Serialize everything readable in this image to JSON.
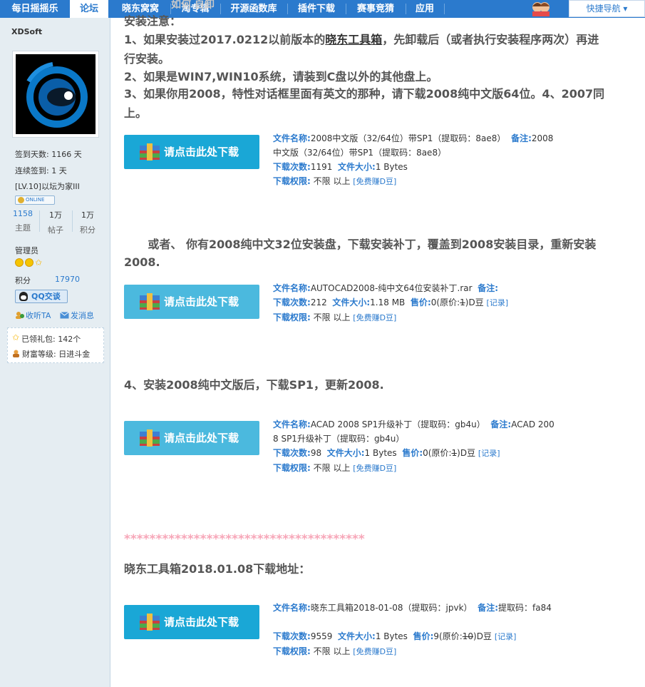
{
  "nav": {
    "items": [
      "每日摇摇乐",
      "论坛",
      "晓东窝窝",
      "淘专辑",
      "开源函数库",
      "插件下载",
      "赛事竞猜",
      "应用"
    ],
    "active_index": 1,
    "quick_nav": "快捷导航 ▾"
  },
  "sidebar": {
    "username": "XDSoft",
    "sign_days": "签到天数: 1166 天",
    "cont_days": "连续签到: 1 天",
    "level": "[LV.10]以坛为家III",
    "online": "ONLINE",
    "counts": [
      {
        "num": "1158",
        "label": "主题"
      },
      {
        "num": "1万",
        "label": "帖子"
      },
      {
        "num": "1万",
        "label": "积分"
      }
    ],
    "role": "管理员",
    "points_label": "积分",
    "points_value": "17970",
    "qq_button": "QQ交谈",
    "follow": "收听TA",
    "message": "发消息",
    "gifts": "已领礼包: 142个",
    "wealth": "财富等级: 日进斗金"
  },
  "content": {
    "ghost": "如何 自卸",
    "p1_l1": "安装注意：",
    "p1_l2_a": "1、如果安装过2017.0212以前版本的",
    "p1_l2_link": "晓东工具箱",
    "p1_l2_b": "，先卸载后（或者执行安装程序两次）再进",
    "p1_l3": "行安装。",
    "p1_l4": "2、如果是WIN7,WIN10系统，请装到C盘以外的其他盘上。",
    "p1_l5": "3、如果你用2008，特性对话框里面有英文的那种，请下载2008纯中文版64位。4、2007同",
    "p1_l6": "上。",
    "p2_l1": "      或者、 你有2008纯中文32位安装盘，下载安装补丁，覆盖到2008安装目录，重新安装",
    "p2_l2": "2008.",
    "p3": "4、安装2008纯中文版后，下载SP1，更新2008.",
    "stars": "**************************************",
    "p4": "晓东工具箱2018.01.08下载地址："
  },
  "download_label": "请点击此处下载",
  "downloads": [
    {
      "name_key": "文件名称:",
      "name": "2008中文版（32/64位）带SP1（提取码：8ae8）",
      "note_key": "备注:",
      "note": "2008",
      "note_cont": "中文版（32/64位）带SP1（提取码：8ae8）",
      "count_key": "下载次数:",
      "count": "1191",
      "size_key": "文件大小:",
      "size": "1 Bytes",
      "perm_key": "下载权限:",
      "perm": "不限 以上",
      "free": "[免费赚D豆]"
    },
    {
      "name_key": "文件名称:",
      "name": "AUTOCAD2008-纯中文64位安装补丁.rar",
      "note_key": "备注:",
      "count_key": "下载次数:",
      "count": "212",
      "size_key": "文件大小:",
      "size": "1.18 MB",
      "price_key": "售价:",
      "price_a": "0(原价:",
      "price_old": "1",
      "price_b": ")D豆",
      "record": "[记录]",
      "perm_key": "下载权限:",
      "perm": "不限 以上",
      "free": "[免费赚D豆]"
    },
    {
      "name_key": "文件名称:",
      "name": "ACAD 2008 SP1升级补丁（提取码：gb4u）",
      "note_key": "备注:",
      "note": "ACAD 200",
      "note_cont": "8 SP1升级补丁（提取码：gb4u）",
      "count_key": "下载次数:",
      "count": "98",
      "size_key": "文件大小:",
      "size": "1 Bytes",
      "price_key": "售价:",
      "price_a": "0(原价:",
      "price_old": "1",
      "price_b": ")D豆",
      "record": "[记录]",
      "perm_key": "下载权限:",
      "perm": "不限 以上",
      "free": "[免费赚D豆]"
    },
    {
      "name_key": "文件名称:",
      "name": "晓东工具箱2018-01-08（提取码：jpvk）",
      "note_key": "备注:",
      "note": "提取码：fa84",
      "count_key": "下载次数:",
      "count": "9559",
      "size_key": "文件大小:",
      "size": "1 Bytes",
      "price_key": "售价:",
      "price_a": "9(原价:",
      "price_old": "10",
      "price_b": ")D豆",
      "record": "[记录]",
      "perm_key": "下载权限:",
      "perm": "不限 以上",
      "free": "[免费赚D豆]"
    }
  ]
}
